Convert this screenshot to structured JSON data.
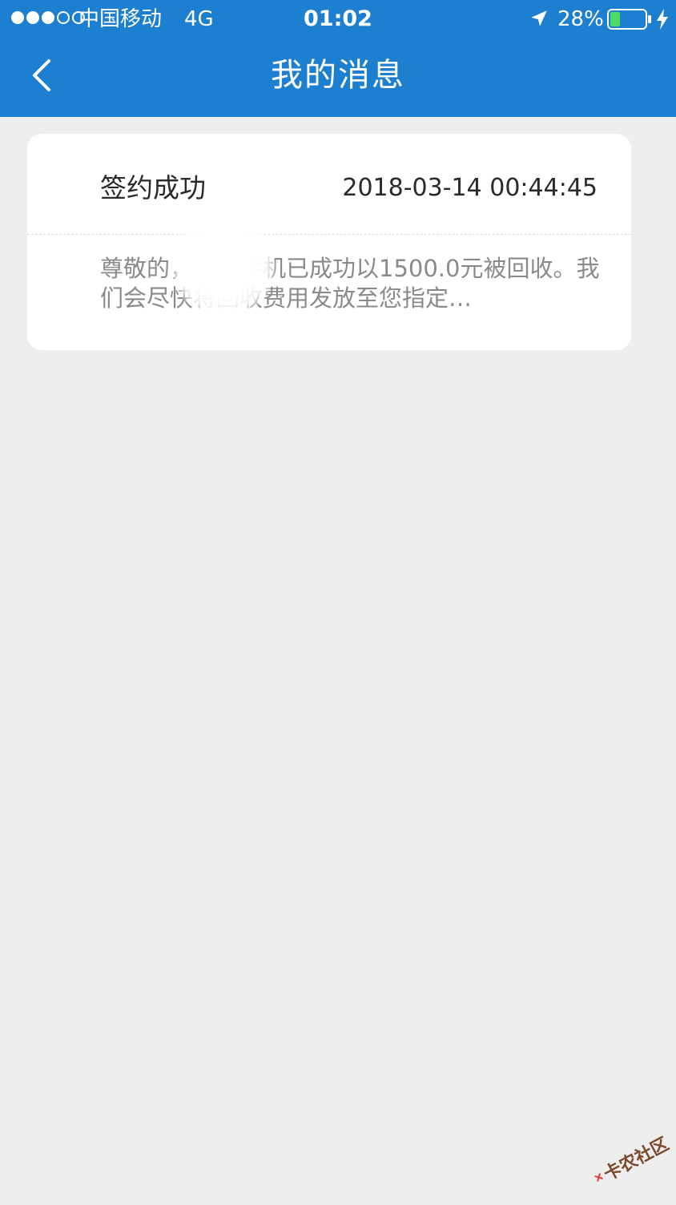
{
  "status_bar": {
    "signal_dots": [
      true,
      true,
      true,
      false,
      false
    ],
    "carrier": "中国移动",
    "network": "4G",
    "time": "01:02",
    "battery_percent": "28%",
    "battery_level": 0.28,
    "icons": [
      "location-arrow-icon",
      "battery-icon",
      "charging-bolt-icon"
    ]
  },
  "nav": {
    "back_icon": "chevron-left-icon",
    "title": "我的消息"
  },
  "messages": [
    {
      "title": "签约成功",
      "time": "2018-03-14 00:44:45",
      "body": "尊敬的，您的手机已成功以1500.0元被回收。我们会尽快将回收费用发放至您指定…"
    }
  ],
  "watermark": {
    "text": "卡农社区"
  },
  "colors": {
    "header_blue": "#1d7fd0",
    "background": "#eeeeef",
    "battery_green": "#4cd964"
  }
}
